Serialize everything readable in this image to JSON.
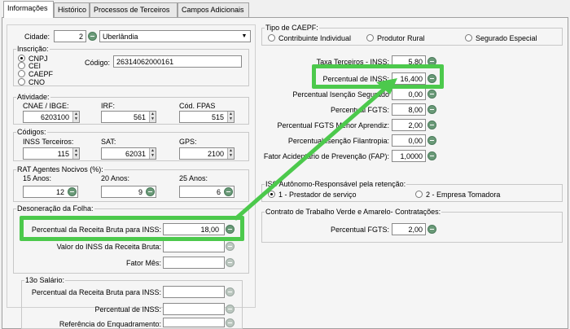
{
  "tabs": [
    {
      "label": "Informações"
    },
    {
      "label": "Histórico"
    },
    {
      "label": "Processos de Terceiros"
    },
    {
      "label": "Campos Adicionais"
    }
  ],
  "cidade": {
    "label": "Cidade:",
    "code": "2",
    "name": "Uberlândia"
  },
  "inscricao": {
    "legend": "Inscrição:",
    "options": [
      "CNPJ",
      "CEI",
      "CAEPF",
      "CNO"
    ],
    "selected": "CNPJ",
    "codigo_label": "Código:",
    "codigo_value": "26314062000161"
  },
  "atividade": {
    "legend": "Atividade:",
    "fields": [
      {
        "label": "CNAE / IBGE:",
        "value": "6203100"
      },
      {
        "label": "IRF:",
        "value": "561"
      },
      {
        "label": "Cód. FPAS",
        "value": "515"
      }
    ]
  },
  "codigos": {
    "legend": "Códigos:",
    "fields": [
      {
        "label": "INSS Terceiros:",
        "value": "115"
      },
      {
        "label": "SAT:",
        "value": "62031"
      },
      {
        "label": "GPS:",
        "value": "2100"
      }
    ]
  },
  "rat": {
    "legend": "RAT Agentes Nocivos (%):",
    "fields": [
      {
        "label": "15 Anos:",
        "value": "12"
      },
      {
        "label": "20 Anos:",
        "value": "9"
      },
      {
        "label": "25 Anos:",
        "value": "6"
      }
    ]
  },
  "desoneracao": {
    "legend": "Desoneração da Folha:",
    "fields": [
      {
        "label": "Percentual da Receita Bruta para INSS:",
        "value": "18,00"
      },
      {
        "label": "Valor do INSS da Receita Bruta:",
        "value": ""
      },
      {
        "label": "Fator Mês:",
        "value": ""
      }
    ]
  },
  "decimo": {
    "legend": "13o Salário:",
    "fields": [
      {
        "label": "Percentual da Receita Bruta para INSS:",
        "value": ""
      },
      {
        "label": "Percentual de INSS:",
        "value": ""
      },
      {
        "label": "Referência do Enquadramento:",
        "value": ""
      }
    ]
  },
  "tipo_caepf": {
    "legend": "Tipo de CAEPF:",
    "options": [
      "Contribuinte Individual",
      "Produtor Rural",
      "Segurado Especial"
    ]
  },
  "taxas": {
    "fields": [
      {
        "label": "Taxa Terceiros - INSS:",
        "value": "5,80"
      },
      {
        "label": "Percentual de INSS:",
        "value": "16,400"
      },
      {
        "label": "Percentual Isenção Segurado",
        "value": "0,00"
      },
      {
        "label": "Percentual FGTS:",
        "value": "8,00"
      },
      {
        "label": "Percentual FGTS Menor Aprendiz:",
        "value": "2,00"
      },
      {
        "label": "Percentual Isenção Filantropia:",
        "value": "0,00"
      },
      {
        "label": "Fator Acidentário de Prevenção (FAP):",
        "value": "1,0000"
      }
    ]
  },
  "iss": {
    "legend": "ISS Autônomo-Responsável pela retenção:",
    "options": [
      "1 - Prestador de serviço",
      "2 - Empresa Tomadora"
    ],
    "selected": "1 - Prestador de serviço"
  },
  "contrato": {
    "legend": "Contrato de Trabalho Verde e Amarelo- Contratações:",
    "field_label": "Percentual FGTS:",
    "field_value": "2,00"
  },
  "colors": {
    "highlight": "#4cc94c",
    "panel_bg": "#f5f5f5"
  }
}
